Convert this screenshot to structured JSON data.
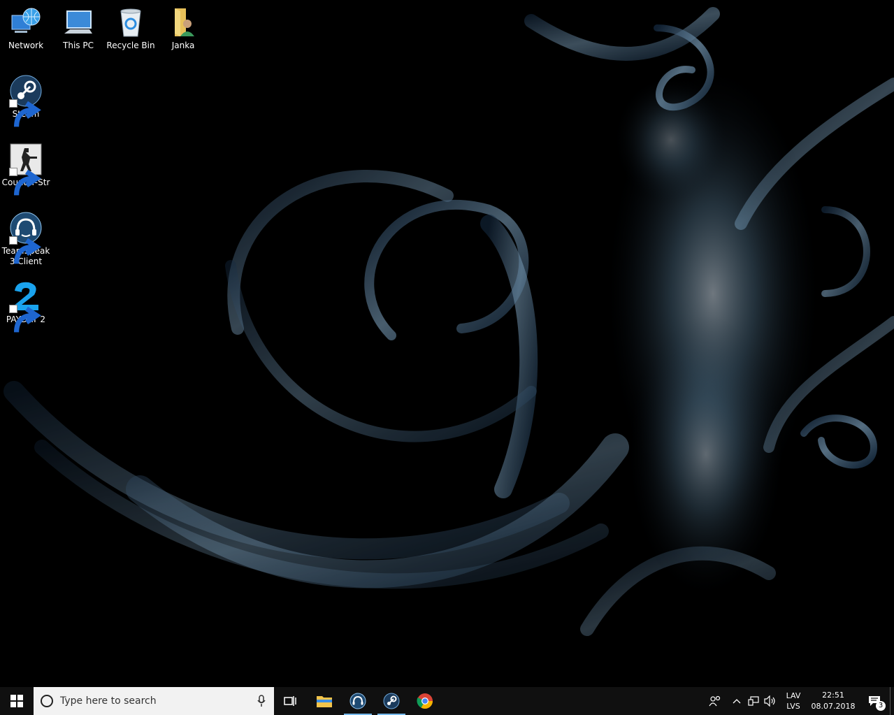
{
  "desktop": {
    "icons": [
      {
        "label": "Network",
        "icon": "network-icon"
      },
      {
        "label": "This PC",
        "icon": "computer-icon"
      },
      {
        "label": "Recycle Bin",
        "icon": "recycle-bin-icon"
      },
      {
        "label": "Janka",
        "icon": "user-folder-icon"
      },
      {
        "label": "Steam",
        "icon": "steam-icon"
      },
      {
        "label": "Counter-Str",
        "icon": "counter-strike-icon"
      },
      {
        "label": "TeamSpeak 3 Client",
        "icon": "teamspeak-icon"
      },
      {
        "label": "PAYDAY 2",
        "icon": "payday-icon"
      }
    ]
  },
  "taskbar": {
    "search_placeholder": "Type here to search",
    "pinned": [
      {
        "name": "task-view",
        "icon": "task-view-icon"
      },
      {
        "name": "file-explorer",
        "icon": "folder-icon"
      },
      {
        "name": "teamspeak",
        "icon": "teamspeak-icon"
      },
      {
        "name": "steam",
        "icon": "steam-icon"
      },
      {
        "name": "chrome",
        "icon": "chrome-icon"
      }
    ],
    "tray": {
      "lang_top": "LAV",
      "lang_bottom": "LVS",
      "time": "22:51",
      "date": "08.07.2018",
      "notification_count": "3"
    }
  },
  "colors": {
    "taskbar_bg": "#101010",
    "accent": "#76b9ed",
    "wallpaper_glow": "#9cc6e6"
  }
}
